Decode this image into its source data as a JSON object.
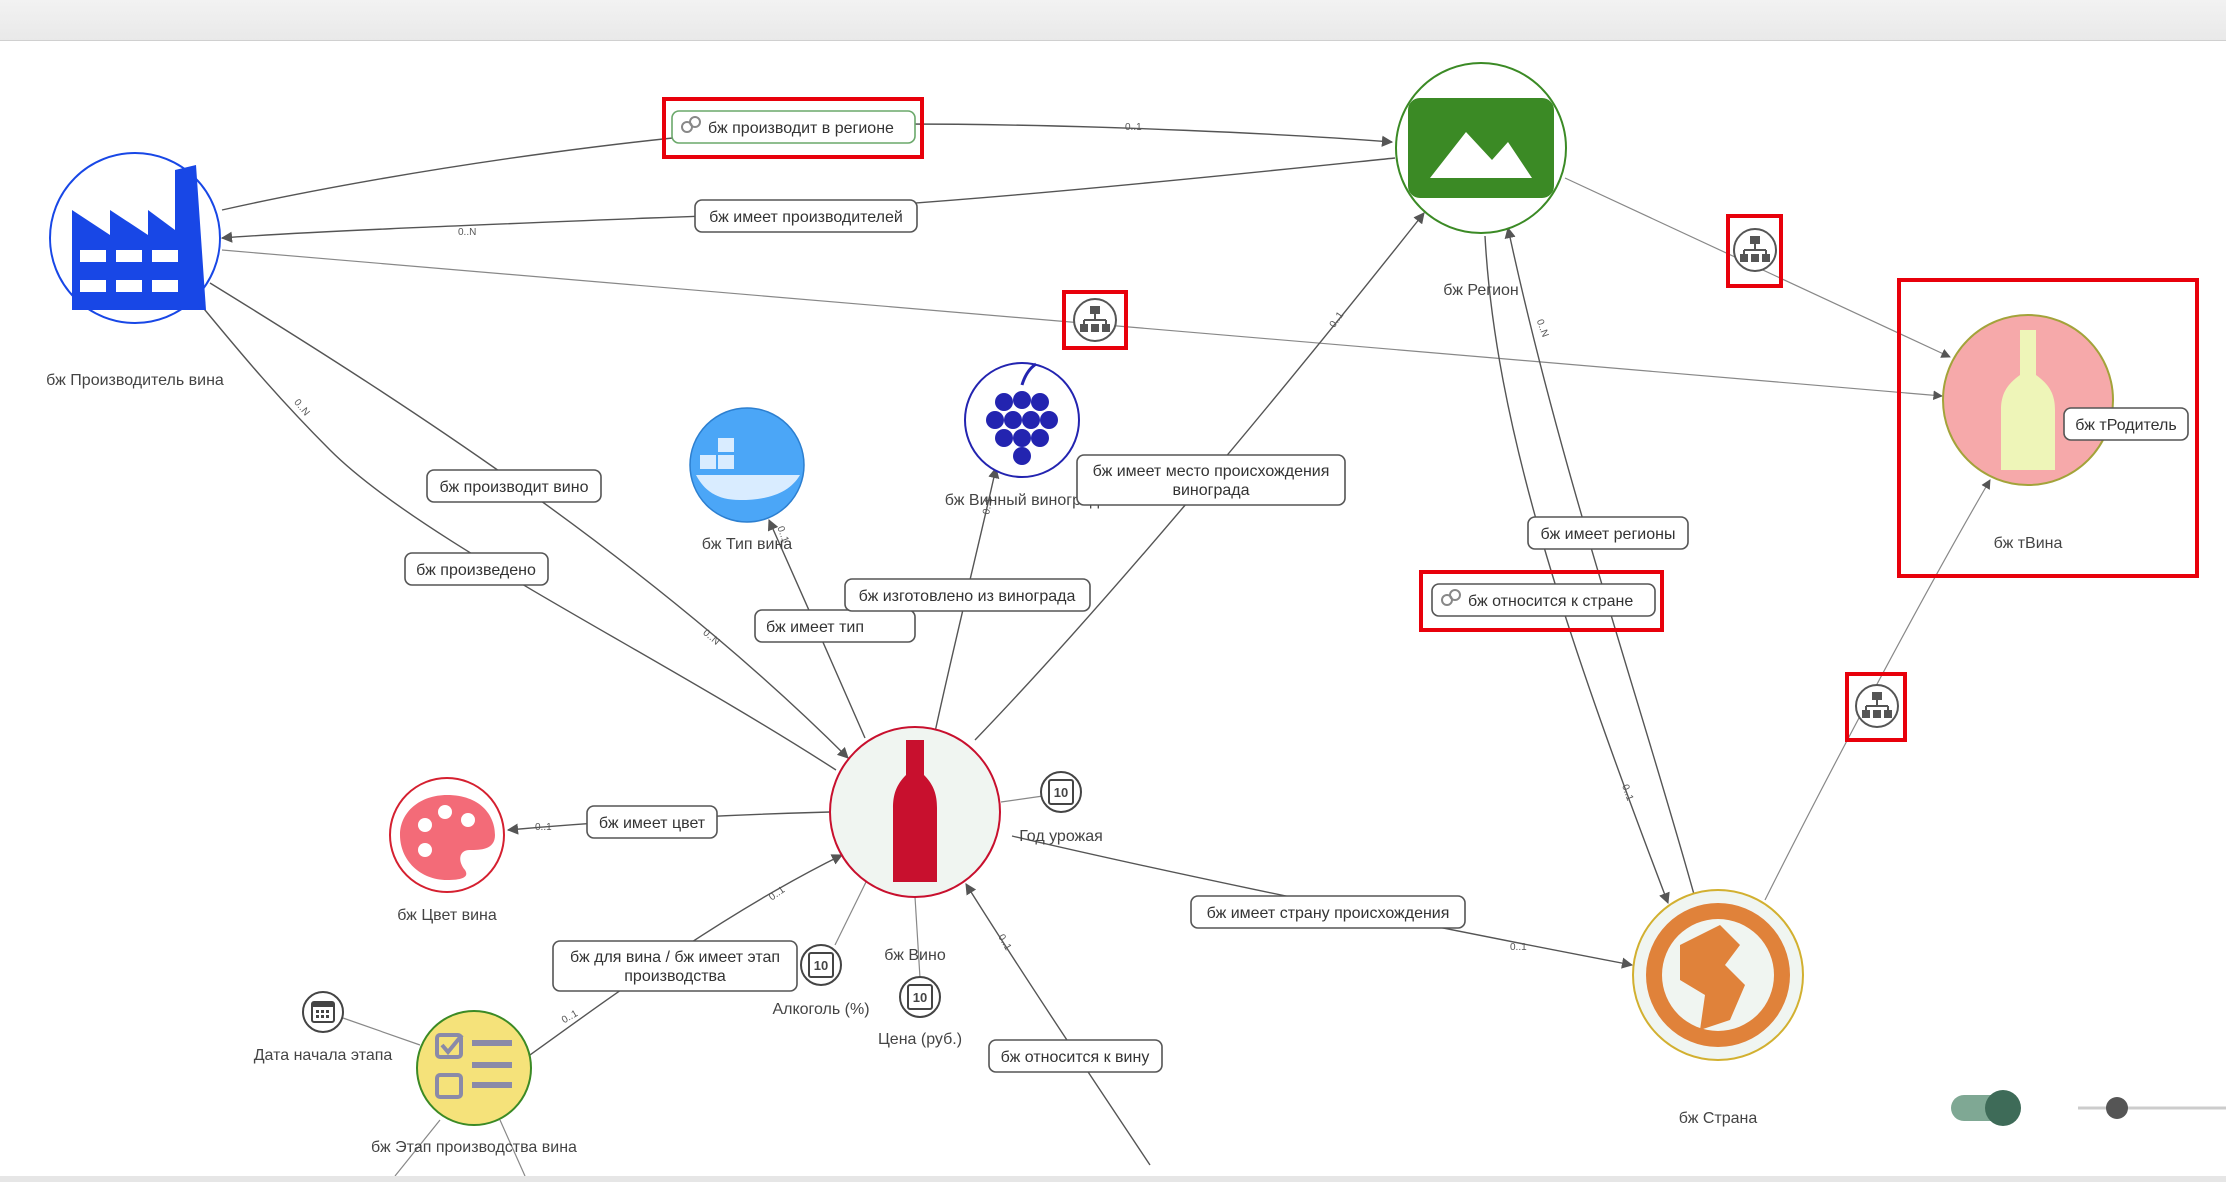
{
  "nodes": {
    "producer": {
      "label": "бж Производитель вина",
      "icon": "factory-icon",
      "color": "#1847e6"
    },
    "region": {
      "label": "бж Регион",
      "icon": "mountains-icon",
      "color": "#3b8a25"
    },
    "twine": {
      "label": "бж тВина",
      "icon": "bottle-icon",
      "color": "#f6a9aa"
    },
    "type": {
      "label": "бж Тип вина",
      "icon": "ship-icon",
      "color": "#4ba6f7"
    },
    "grape": {
      "label": "бж Винный виноград",
      "icon": "grapes-icon",
      "color": "#2324b0"
    },
    "color": {
      "label": "бж Цвет вина",
      "icon": "palette-icon",
      "color": "#f36b78"
    },
    "wine": {
      "label": "бж Вино",
      "icon": "wine-bottle-icon",
      "color": "#c8102e"
    },
    "country": {
      "label": "бж Страна",
      "icon": "globe-icon",
      "color": "#e0823a"
    },
    "stage": {
      "label": "бж Этап производства вина",
      "icon": "checklist-icon",
      "color": "#f5e27a"
    }
  },
  "attributes": {
    "harvest_year": "Год урожая",
    "alcohol": "Алкоголь (%)",
    "price": "Цена (руб.)",
    "stage_start": "Дата начала этапа",
    "number_glyph": "10"
  },
  "edges": {
    "produces_in_region": "бж производит в регионе",
    "has_producers": "бж имеет производителей",
    "produces_wine": "бж производит вино",
    "produced": "бж произведено",
    "has_type": "бж имеет тип",
    "made_from_grape": "бж изготовлено из винограда",
    "grape_origin_line1": "бж имеет место происхождения",
    "grape_origin_line2": "винограда",
    "has_regions": "бж имеет регионы",
    "belongs_to_country": "бж относится к стране",
    "has_color": "бж имеет цвет",
    "has_origin_country": "бж имеет страну происхождения",
    "stage_line1": "бж для вина / бж имеет этап",
    "stage_line2": "производства",
    "belongs_to_wine": "бж относится к вину",
    "parent": "бж тРодитель"
  },
  "cardinalities": {
    "zero_one": "0..1",
    "zero_n": "0..N"
  },
  "controls": {
    "toggle_on": true
  }
}
